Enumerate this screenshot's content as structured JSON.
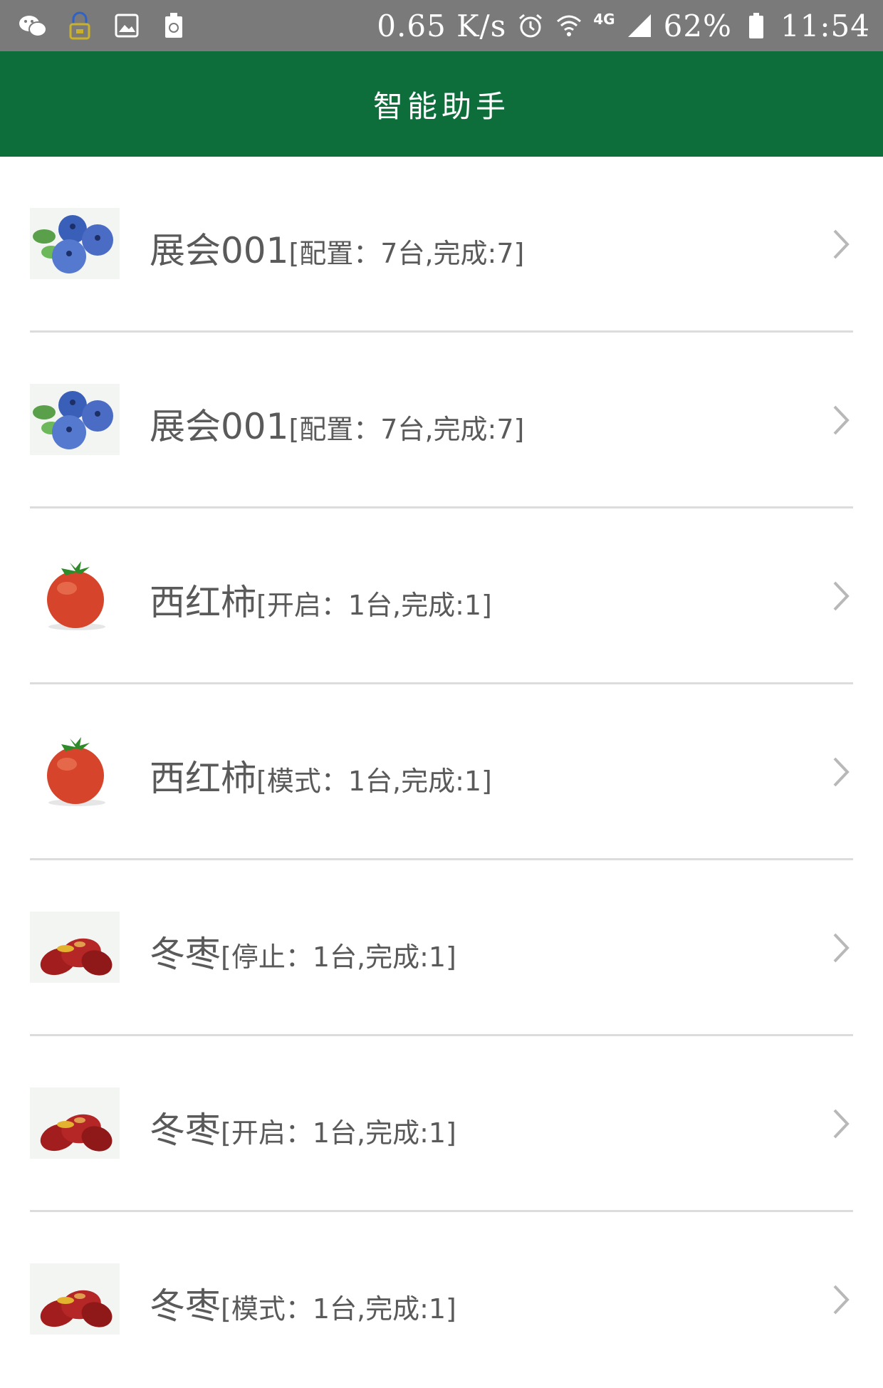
{
  "status_bar": {
    "speed": "0.65 K/s",
    "network": "4G",
    "battery": "62%",
    "time": "11:54",
    "icons": [
      "wechat-icon",
      "lock-icon",
      "image-icon",
      "recycle-icon",
      "alarm-icon",
      "wifi-icon",
      "signal-icon",
      "battery-icon"
    ]
  },
  "header": {
    "title": "智能助手",
    "color": "#0d6e3c"
  },
  "list": [
    {
      "icon": "blueberry-icon",
      "name": "展会001",
      "detail": "[配置：7台,完成:7]"
    },
    {
      "icon": "blueberry-icon",
      "name": "展会001",
      "detail": "[配置：7台,完成:7]"
    },
    {
      "icon": "tomato-icon",
      "name": "西红柿",
      "detail": "[开启：1台,完成:1]"
    },
    {
      "icon": "tomato-icon",
      "name": "西红柿",
      "detail": "[模式：1台,完成:1]"
    },
    {
      "icon": "jujube-icon",
      "name": "冬枣",
      "detail": "[停止：1台,完成:1]"
    },
    {
      "icon": "jujube-icon",
      "name": "冬枣",
      "detail": "[开启：1台,完成:1]"
    },
    {
      "icon": "jujube-icon",
      "name": "冬枣",
      "detail": "[模式：1台,完成:1]"
    }
  ]
}
